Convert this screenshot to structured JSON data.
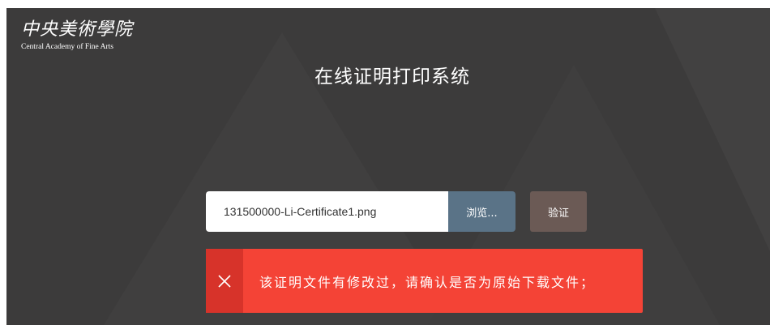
{
  "logo": {
    "name_cn": "中央美術學院",
    "name_en": "Central Academy of Fine Arts"
  },
  "page": {
    "title": "在线证明打印系统"
  },
  "upload": {
    "file_name": "131500000-Li-Certificate1.png",
    "browse_label": "浏览...",
    "verify_label": "验证"
  },
  "alert": {
    "icon": "close-icon",
    "message": "该证明文件有修改过，请确认是否为原始下载文件；"
  },
  "colors": {
    "background": "#3c3b3b",
    "browse_button": "#5a7387",
    "verify_button": "#6b5a55",
    "alert": "#f44336",
    "alert_icon_area": "#d7332a"
  }
}
